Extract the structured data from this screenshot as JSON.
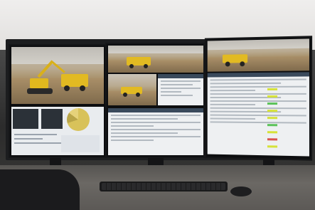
{
  "scene": {
    "description_hidden": "",
    "colors": {
      "wall": "#e5e3e1",
      "machinery": "#e0b81e",
      "desk": "#5f5c58",
      "monitor_frame": "#0d0e10",
      "highlight_yellow": "#d6e23a",
      "highlight_green": "#5cc35a"
    },
    "icons": [
      "excavator-icon",
      "dump-truck-icon",
      "pie-chart-icon"
    ]
  }
}
